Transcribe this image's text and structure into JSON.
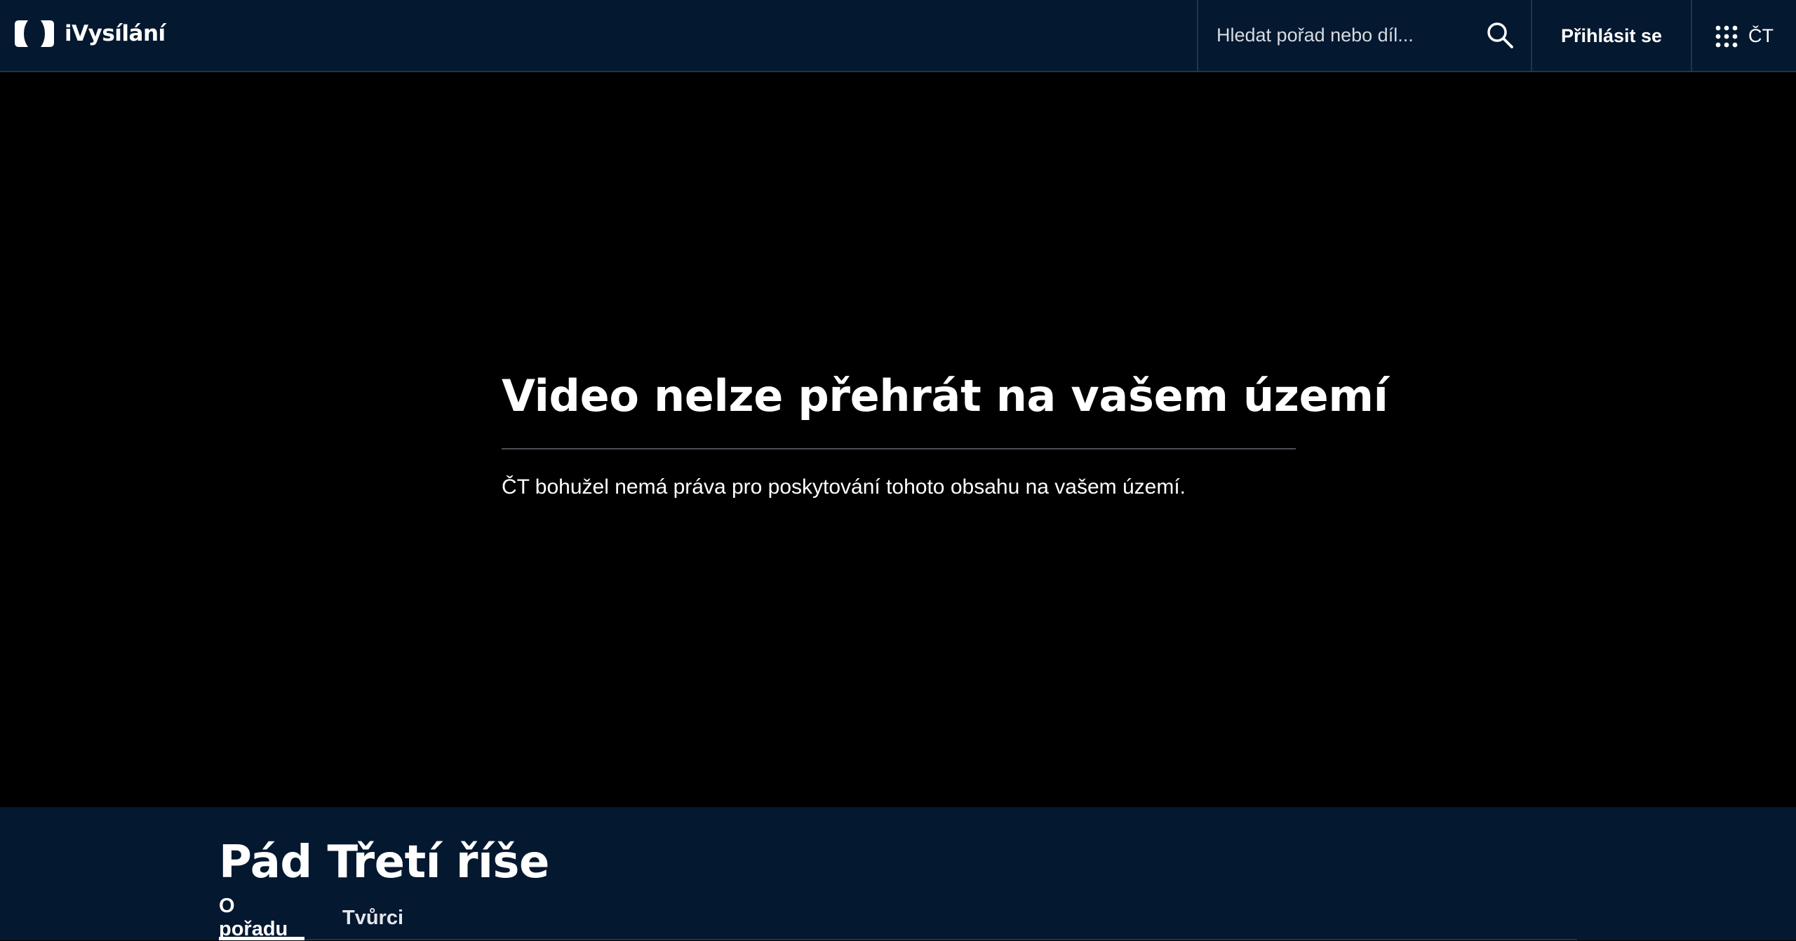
{
  "header": {
    "logo_text": "iVysílání",
    "search": {
      "placeholder": "Hledat pořad nebo díl..."
    },
    "login_label": "Přihlásit se",
    "menu_label": "ČT"
  },
  "player": {
    "message_title": "Video nelze přehrát na vašem území",
    "message_text": "ČT bohužel nemá práva pro poskytování tohoto obsahu na vašem území."
  },
  "show": {
    "title": "Pád Třetí říše",
    "tabs": [
      {
        "label": "O pořadu",
        "active": true
      },
      {
        "label": "Tvůrci",
        "active": false
      }
    ]
  },
  "icons": {
    "logo": "ct-logo-icon",
    "search": "search-icon",
    "apps": "grid-icon"
  },
  "colors": {
    "header_bg": "#041830",
    "player_bg": "#000000",
    "text": "#ffffff",
    "divider": "#4a4f57"
  }
}
